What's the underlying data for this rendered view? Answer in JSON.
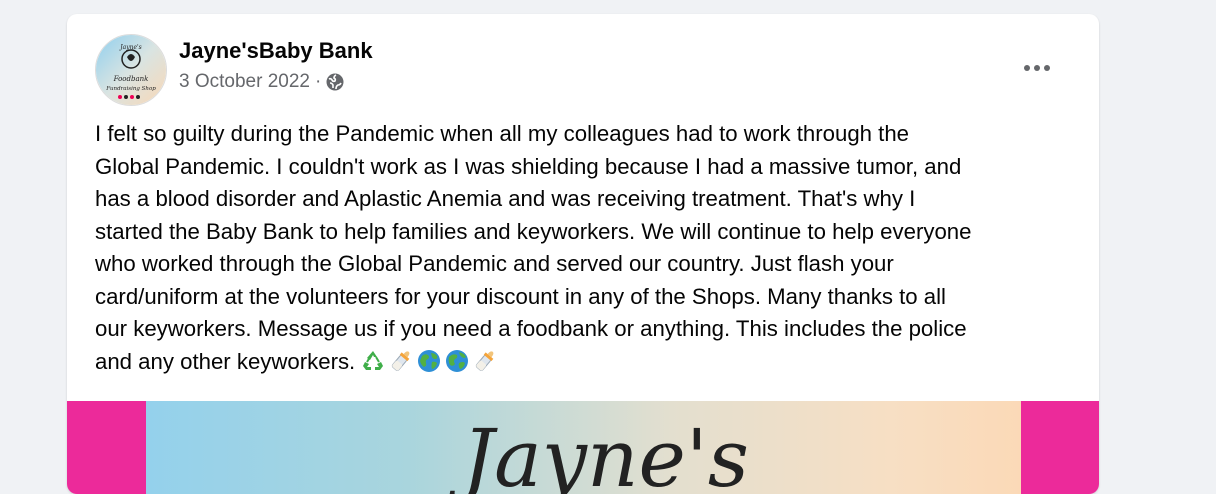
{
  "post": {
    "page_name": "Jayne'sBaby Bank",
    "date": "3 October 2022",
    "separator": "·",
    "privacy_icon": "globe-icon",
    "more_icon": "more-options-icon",
    "avatar": {
      "label": "Jayne's Foodbank Fundraising Shop",
      "line1": "Jayne's",
      "line2": "Foodbank",
      "line3": "Fundraising Shop"
    },
    "text_lines": [
      "I felt so guilty during the Pandemic when all my colleagues had to work through the",
      "Global Pandemic. I couldn't work as I was shielding because I had a massive tumor, and",
      "has a blood disorder and Aplastic Anemia and was receiving treatment. That's why I",
      "started the Baby Bank to help families and keyworkers. We will continue to help everyone",
      "who worked through the Global Pandemic and served our country. Just flash your",
      "card/uniform at the volunteers for your discount in any of the Shops. Many thanks to all",
      "our keyworkers. Message us if you need a foodbank or anything. This includes the police",
      "and any other keyworkers."
    ],
    "emojis": [
      "recycle-icon",
      "baby-bottle-icon",
      "globe-earth-icon",
      "globe-earth-icon",
      "baby-bottle-icon"
    ],
    "image_text": "Jayne's",
    "colors": {
      "image_side": "#ec2a9a",
      "text": "#050505",
      "meta": "#65676b"
    }
  }
}
